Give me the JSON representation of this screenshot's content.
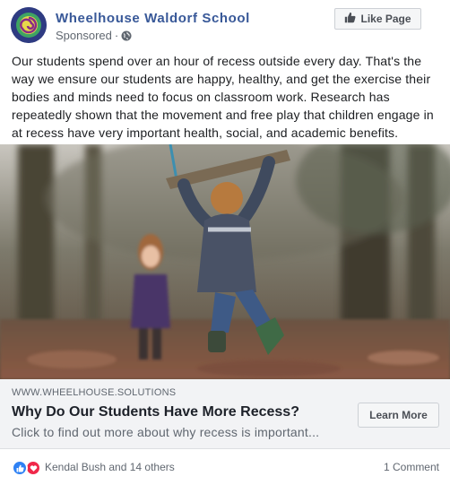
{
  "header": {
    "page_name": "Wheelhouse Waldorf School",
    "sponsored_label": "Sponsored",
    "separator": "·",
    "like_page_label": "Like Page"
  },
  "post": {
    "text": "Our students spend over an hour of recess outside every day. That's the way we ensure our students are happy, healthy, and get the exercise their bodies and minds need to focus on classroom work. Research has repeatedly shown that the movement and free play that children engage in at recess have very important health, social, and academic benefits."
  },
  "link_preview": {
    "domain": "WWW.WHEELHOUSE.SOLUTIONS",
    "title": "Why Do Our Students Have More Recess?",
    "description": "Click to find out more about why recess is important...",
    "cta_label": "Learn More"
  },
  "footer": {
    "reactors_text": "Kendal Bush and 14 others",
    "comments_text": "1 Comment"
  },
  "colors": {
    "link_blue": "#385898",
    "like_blue": "#2e81f4",
    "love_red": "#f0284a",
    "muted_text": "#606770"
  }
}
